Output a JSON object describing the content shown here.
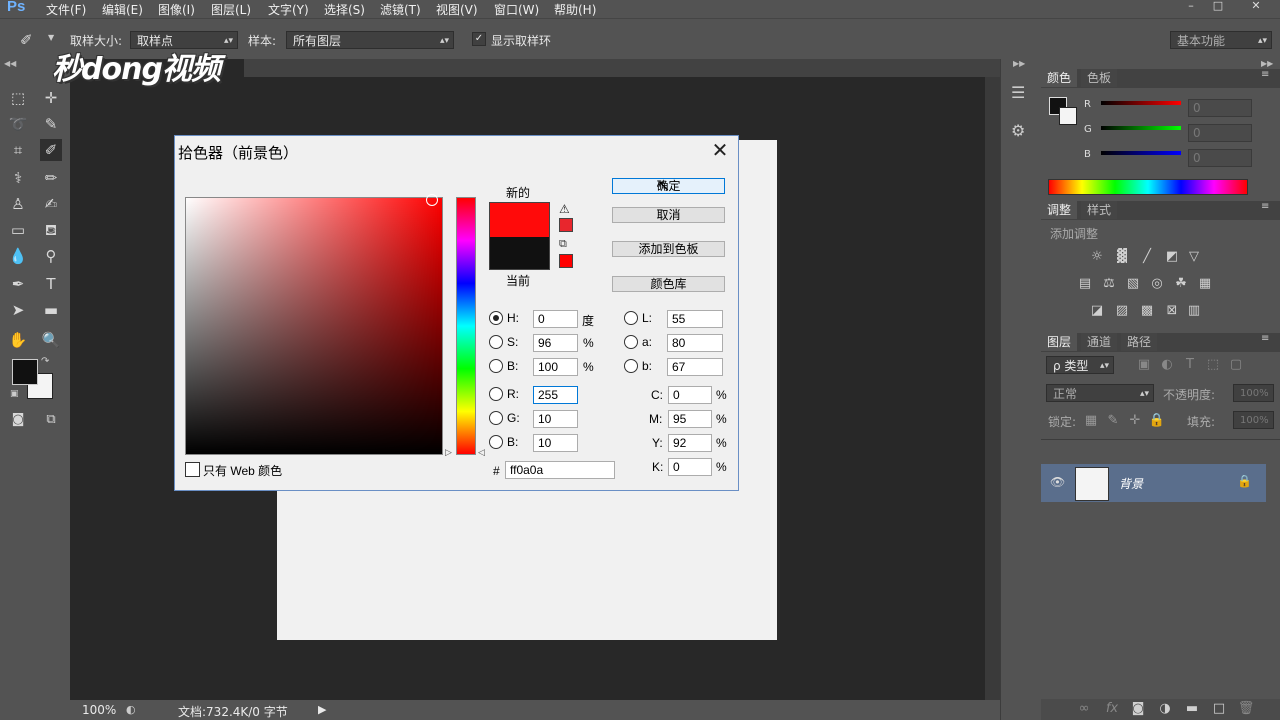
{
  "app": {
    "logo": "Ps"
  },
  "menu": [
    "文件(F)",
    "编辑(E)",
    "图像(I)",
    "图层(L)",
    "文字(Y)",
    "选择(S)",
    "滤镜(T)",
    "视图(V)",
    "窗口(W)",
    "帮助(H)"
  ],
  "options_bar": {
    "sample_size_label": "取样大小:",
    "sample_size_value": "取样点",
    "sample_label": "样本:",
    "sample_value": "所有图层",
    "show_ring_label": "显示取样环",
    "workspace": "基本功能"
  },
  "watermark": "秒dong视频",
  "status": {
    "zoom": "100%",
    "doc": "文档:732.4K/0 字节"
  },
  "color_panel": {
    "tabs": [
      "颜色",
      "色板"
    ],
    "channels": [
      {
        "label": "R",
        "value": "0"
      },
      {
        "label": "G",
        "value": "0"
      },
      {
        "label": "B",
        "value": "0"
      }
    ]
  },
  "adjust_panel": {
    "tabs": [
      "调整",
      "样式"
    ],
    "title": "添加调整"
  },
  "layers_panel": {
    "tabs": [
      "图层",
      "通道",
      "路径"
    ],
    "filter": "ρ 类型",
    "blend_mode": "正常",
    "opacity_label": "不透明度:",
    "opacity_value": "100%",
    "lock_label": "锁定:",
    "fill_label": "填充:",
    "fill_value": "100%",
    "layer_name": "背景"
  },
  "dialog": {
    "title": "拾色器（前景色）",
    "new_label": "新的",
    "current_label": "当前",
    "new_color": "#ff0a0a",
    "current_color": "#111111",
    "buttons": {
      "ok": "确定",
      "cancel": "取消",
      "add_swatch": "添加到色板",
      "libraries": "颜色库"
    },
    "hsb": [
      {
        "label": "H:",
        "value": "0",
        "unit": "度"
      },
      {
        "label": "S:",
        "value": "96",
        "unit": "%"
      },
      {
        "label": "B:",
        "value": "100",
        "unit": "%"
      }
    ],
    "rgb": [
      {
        "label": "R:",
        "value": "255"
      },
      {
        "label": "G:",
        "value": "10"
      },
      {
        "label": "B:",
        "value": "10"
      }
    ],
    "lab": [
      {
        "label": "L:",
        "value": "55"
      },
      {
        "label": "a:",
        "value": "80"
      },
      {
        "label": "b:",
        "value": "67"
      }
    ],
    "cmyk": [
      {
        "label": "C:",
        "value": "0",
        "unit": "%"
      },
      {
        "label": "M:",
        "value": "95",
        "unit": "%"
      },
      {
        "label": "Y:",
        "value": "92",
        "unit": "%"
      },
      {
        "label": "K:",
        "value": "0",
        "unit": "%"
      }
    ],
    "hex_label": "#",
    "hex_value": "ff0a0a",
    "web_only_label": "只有 Web 颜色"
  }
}
